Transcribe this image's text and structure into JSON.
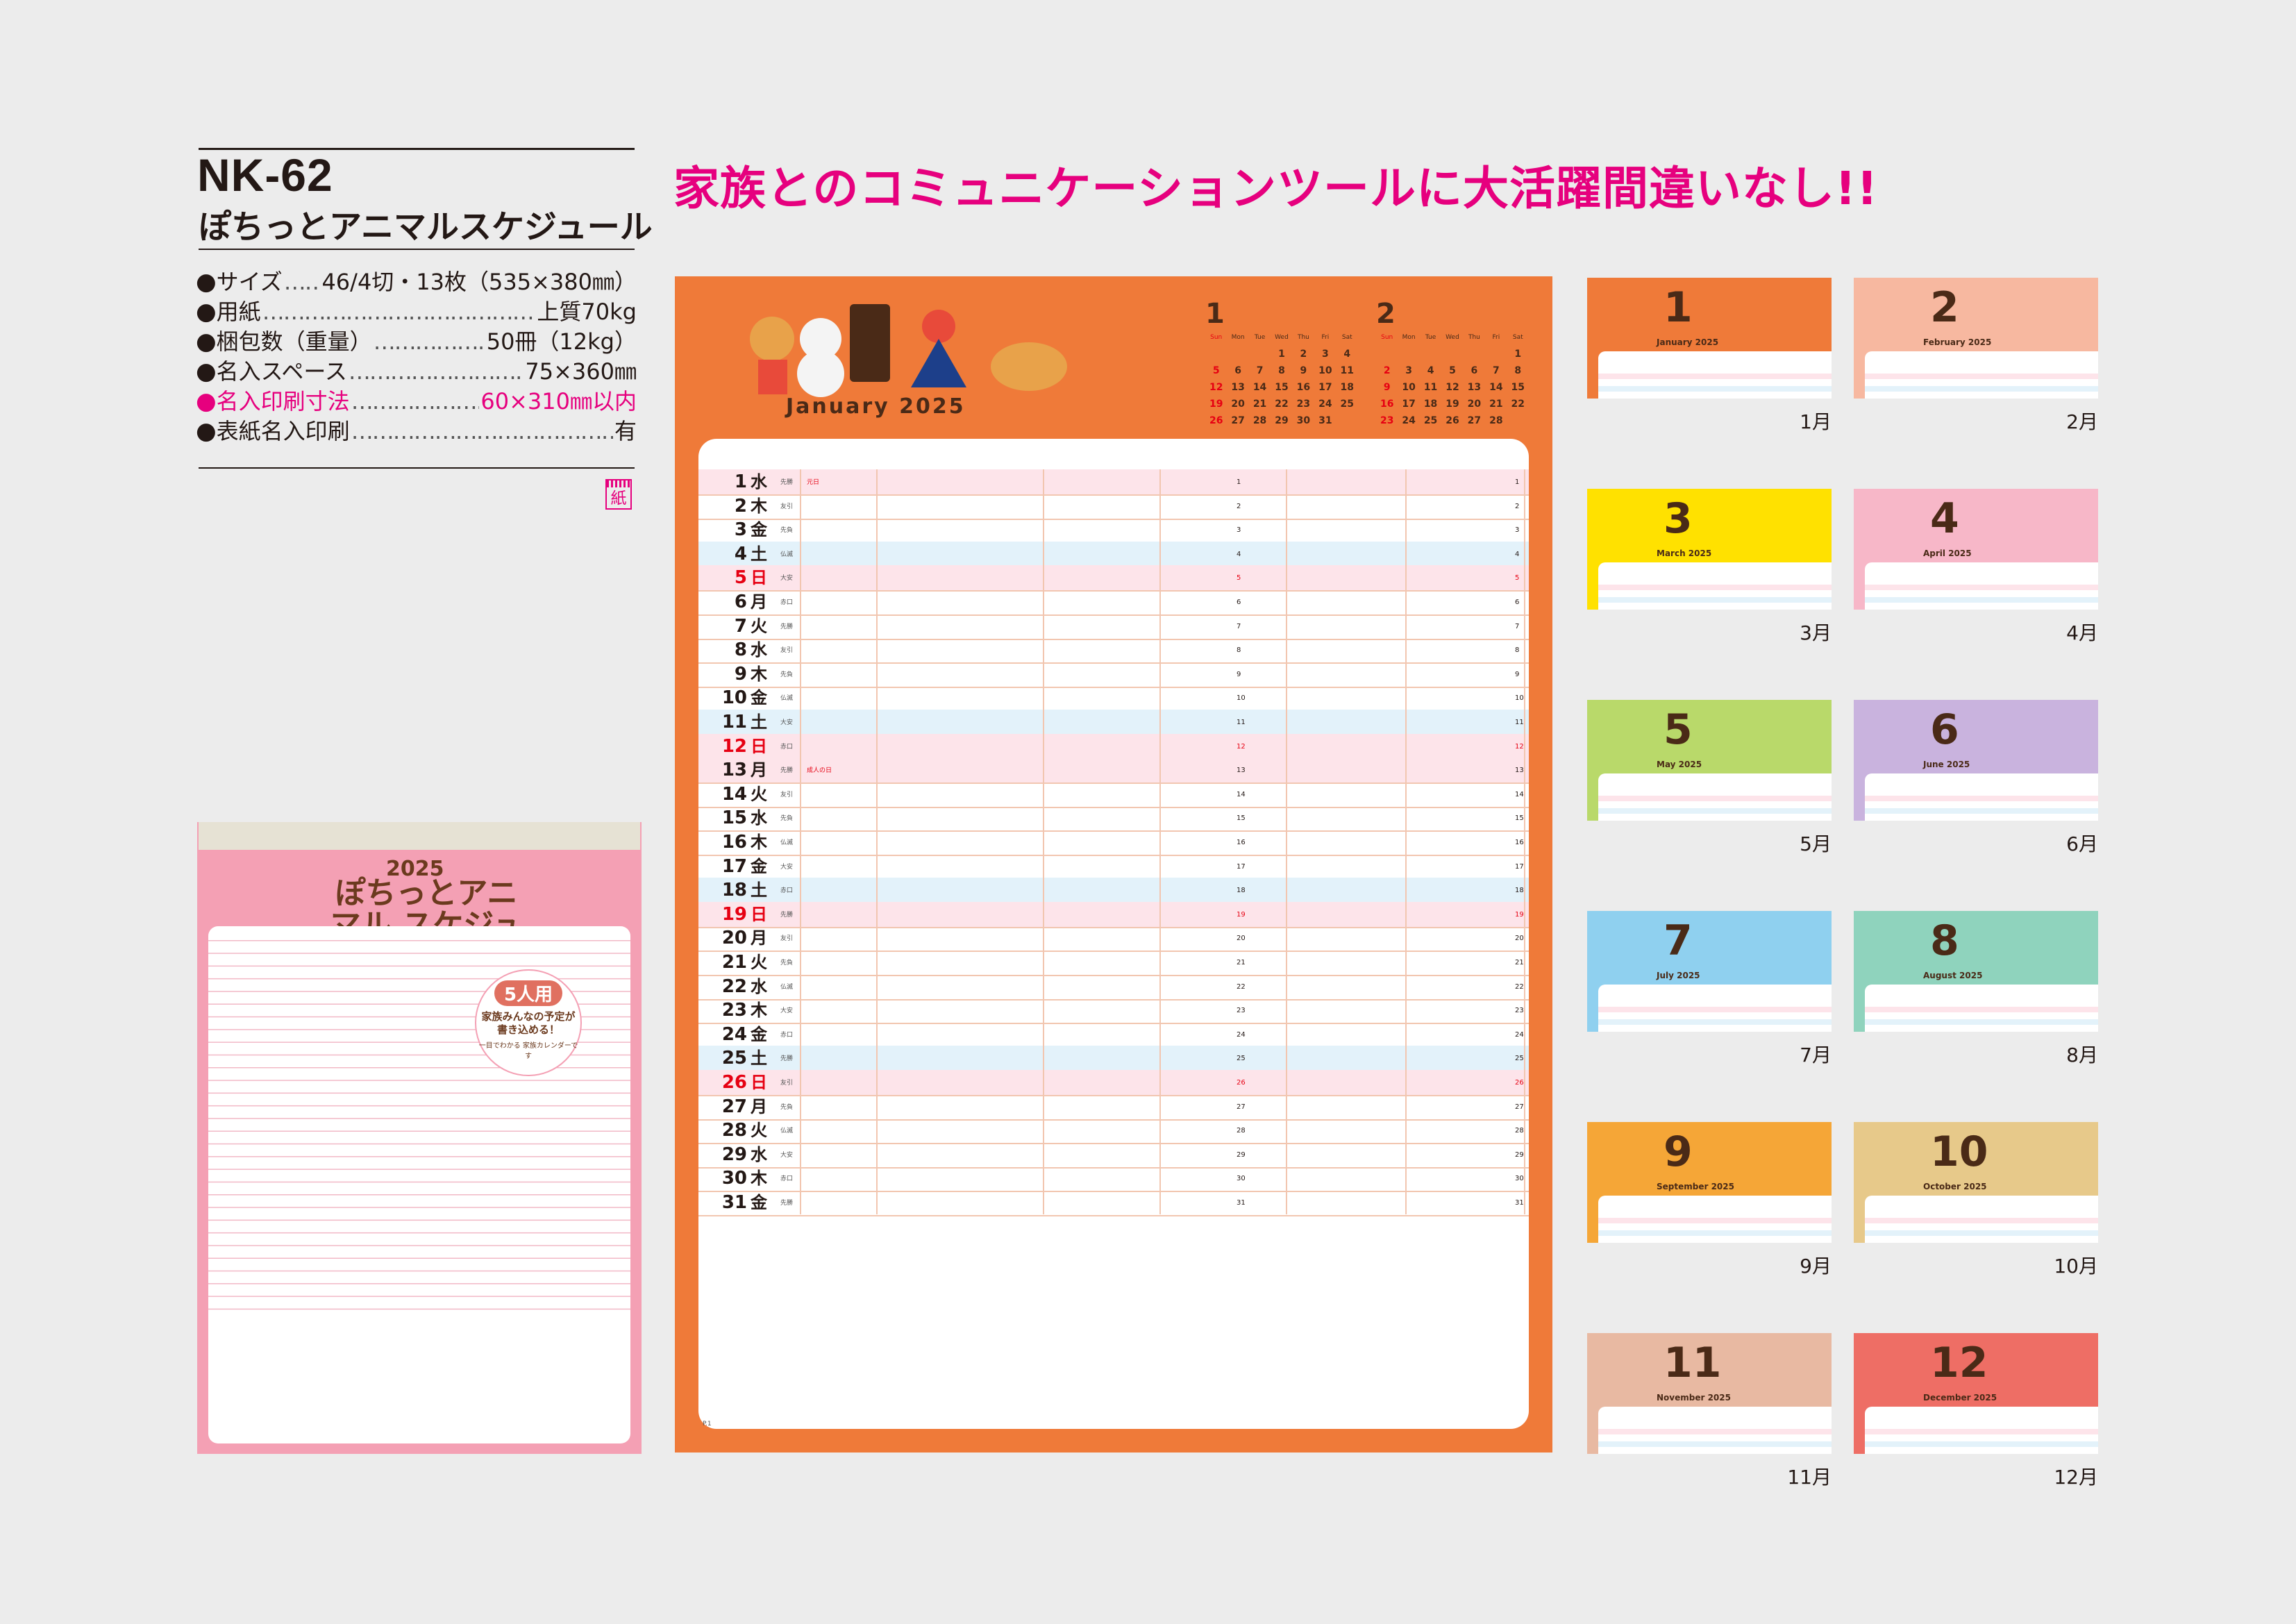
{
  "product": {
    "model": "NK-62",
    "name": "ぽちっとアニマルスケジュール",
    "headline": "家族とのコミュニケーションツールに大活躍間違いなし!!",
    "paper_badge": "紙"
  },
  "specs": [
    {
      "label": "サイズ",
      "value": "46/4切・13枚（535×380㎜）",
      "highlight": false
    },
    {
      "label": "用紙",
      "value": "上質70kg",
      "highlight": false
    },
    {
      "label": "梱包数（重量）",
      "value": "50冊（12kg）",
      "highlight": false
    },
    {
      "label": "名入スペース",
      "value": "75×360㎜",
      "highlight": false
    },
    {
      "label": "名入印刷寸法",
      "value": "60×310㎜以内",
      "highlight": true
    },
    {
      "label": "表紙名入印刷",
      "value": "有",
      "highlight": false
    }
  ],
  "cover": {
    "year": "2025",
    "title": "ぽちっとアニマル スケジュール",
    "badge_main": "5人用",
    "badge_sub": "家族みんなの予定が 書き込める！",
    "badge_small": "一目でわかる 家族カレンダーです"
  },
  "big_page": {
    "month_name": "January 2025",
    "page_label": "P.1",
    "mini_calendars": [
      {
        "num": "1",
        "weekdays": [
          "Sun",
          "Mon",
          "Tue",
          "Wed",
          "Thu",
          "Fri",
          "Sat"
        ],
        "days": [
          "",
          "",
          "",
          "1",
          "2",
          "3",
          "4",
          "5",
          "6",
          "7",
          "8",
          "9",
          "10",
          "11",
          "12",
          "13",
          "14",
          "15",
          "16",
          "17",
          "18",
          "19",
          "20",
          "21",
          "22",
          "23",
          "24",
          "25",
          "26",
          "27",
          "28",
          "29",
          "30",
          "31",
          ""
        ]
      },
      {
        "num": "2",
        "weekdays": [
          "Sun",
          "Mon",
          "Tue",
          "Wed",
          "Thu",
          "Fri",
          "Sat"
        ],
        "days": [
          "",
          "",
          "",
          "",
          "",
          "",
          "1",
          "2",
          "3",
          "4",
          "5",
          "6",
          "7",
          "8",
          "9",
          "10",
          "11",
          "12",
          "13",
          "14",
          "15",
          "16",
          "17",
          "18",
          "19",
          "20",
          "21",
          "22",
          "23",
          "24",
          "25",
          "26",
          "27",
          "28",
          ""
        ]
      }
    ],
    "rows": [
      {
        "d": "1",
        "w": "水",
        "r": "先勝",
        "h": "元日",
        "t": "pink"
      },
      {
        "d": "2",
        "w": "木",
        "r": "友引",
        "h": "",
        "t": ""
      },
      {
        "d": "3",
        "w": "金",
        "r": "先負",
        "h": "",
        "t": ""
      },
      {
        "d": "4",
        "w": "土",
        "r": "仏滅",
        "h": "",
        "t": "sat"
      },
      {
        "d": "5",
        "w": "日",
        "r": "大安",
        "h": "",
        "t": "sun"
      },
      {
        "d": "6",
        "w": "月",
        "r": "赤口",
        "h": "",
        "t": ""
      },
      {
        "d": "7",
        "w": "火",
        "r": "先勝",
        "h": "",
        "t": ""
      },
      {
        "d": "8",
        "w": "水",
        "r": "友引",
        "h": "",
        "t": ""
      },
      {
        "d": "9",
        "w": "木",
        "r": "先負",
        "h": "",
        "t": ""
      },
      {
        "d": "10",
        "w": "金",
        "r": "仏滅",
        "h": "",
        "t": ""
      },
      {
        "d": "11",
        "w": "土",
        "r": "大安",
        "h": "",
        "t": "sat"
      },
      {
        "d": "12",
        "w": "日",
        "r": "赤口",
        "h": "",
        "t": "sun"
      },
      {
        "d": "13",
        "w": "月",
        "r": "先勝",
        "h": "成人の日",
        "t": "pink"
      },
      {
        "d": "14",
        "w": "火",
        "r": "友引",
        "h": "",
        "t": ""
      },
      {
        "d": "15",
        "w": "水",
        "r": "先負",
        "h": "",
        "t": ""
      },
      {
        "d": "16",
        "w": "木",
        "r": "仏滅",
        "h": "",
        "t": ""
      },
      {
        "d": "17",
        "w": "金",
        "r": "大安",
        "h": "",
        "t": ""
      },
      {
        "d": "18",
        "w": "土",
        "r": "赤口",
        "h": "",
        "t": "sat"
      },
      {
        "d": "19",
        "w": "日",
        "r": "先勝",
        "h": "",
        "t": "sun"
      },
      {
        "d": "20",
        "w": "月",
        "r": "友引",
        "h": "",
        "t": ""
      },
      {
        "d": "21",
        "w": "火",
        "r": "先負",
        "h": "",
        "t": ""
      },
      {
        "d": "22",
        "w": "水",
        "r": "仏滅",
        "h": "",
        "t": ""
      },
      {
        "d": "23",
        "w": "木",
        "r": "大安",
        "h": "",
        "t": ""
      },
      {
        "d": "24",
        "w": "金",
        "r": "赤口",
        "h": "",
        "t": ""
      },
      {
        "d": "25",
        "w": "土",
        "r": "先勝",
        "h": "",
        "t": "sat"
      },
      {
        "d": "26",
        "w": "日",
        "r": "友引",
        "h": "",
        "t": "sun"
      },
      {
        "d": "27",
        "w": "月",
        "r": "先負",
        "h": "",
        "t": ""
      },
      {
        "d": "28",
        "w": "火",
        "r": "仏滅",
        "h": "",
        "t": ""
      },
      {
        "d": "29",
        "w": "水",
        "r": "大安",
        "h": "",
        "t": ""
      },
      {
        "d": "30",
        "w": "木",
        "r": "赤口",
        "h": "",
        "t": ""
      },
      {
        "d": "31",
        "w": "金",
        "r": "先勝",
        "h": "",
        "t": ""
      }
    ]
  },
  "months": [
    {
      "num": "1",
      "name": "January 2025",
      "label": "1月",
      "color": "#ef7a39"
    },
    {
      "num": "2",
      "name": "February 2025",
      "label": "2月",
      "color": "#f7b8a0"
    },
    {
      "num": "3",
      "name": "March 2025",
      "label": "3月",
      "color": "#ffe100"
    },
    {
      "num": "4",
      "name": "April 2025",
      "label": "4月",
      "color": "#f7b7c8"
    },
    {
      "num": "5",
      "name": "May 2025",
      "label": "5月",
      "color": "#b9d96a"
    },
    {
      "num": "6",
      "name": "June 2025",
      "label": "6月",
      "color": "#c9b3de"
    },
    {
      "num": "7",
      "name": "July 2025",
      "label": "7月",
      "color": "#8fd0ef"
    },
    {
      "num": "8",
      "name": "August 2025",
      "label": "8月",
      "color": "#8fd3bd"
    },
    {
      "num": "9",
      "name": "September 2025",
      "label": "9月",
      "color": "#f5a637"
    },
    {
      "num": "10",
      "name": "October 2025",
      "label": "10月",
      "color": "#e7c98a"
    },
    {
      "num": "11",
      "name": "November 2025",
      "label": "11月",
      "color": "#e8b9a2"
    },
    {
      "num": "12",
      "name": "December 2025",
      "label": "12月",
      "color": "#ee6e65"
    }
  ]
}
